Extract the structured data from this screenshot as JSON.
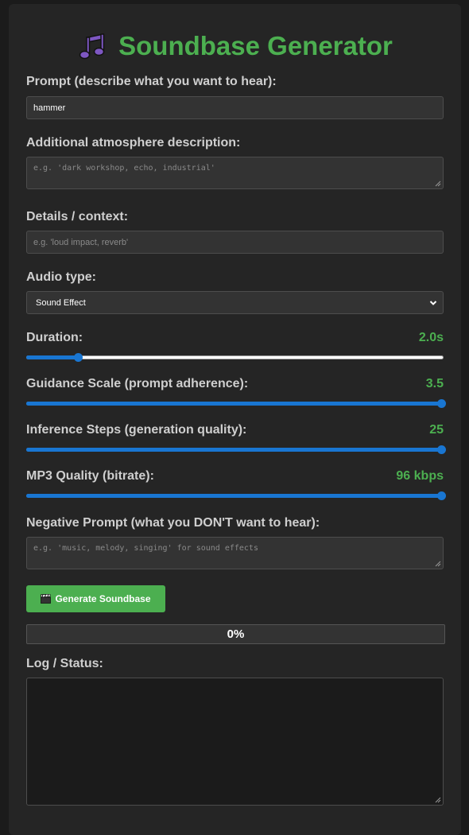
{
  "app": {
    "title": "Soundbase Generator",
    "title_icon": "music-note-icon",
    "accent_color": "#4caf50",
    "slider_color": "#1976d2"
  },
  "form": {
    "prompt": {
      "label": "Prompt (describe what you want to hear):",
      "value": "hammer",
      "placeholder": ""
    },
    "atmosphere": {
      "label": "Additional atmosphere description:",
      "value": "",
      "placeholder": "e.g. 'dark workshop, echo, industrial'"
    },
    "details": {
      "label": "Details / context:",
      "value": "",
      "placeholder": "e.g. 'loud impact, reverb'"
    },
    "audio_type": {
      "label": "Audio type:",
      "selected": "Sound Effect"
    },
    "duration": {
      "label": "Duration:",
      "display": "2.0s",
      "level": 0.12
    },
    "guidance": {
      "label": "Guidance Scale (prompt adherence):",
      "display": "3.5",
      "level": 1.0
    },
    "steps": {
      "label": "Inference Steps (generation quality):",
      "display": "25",
      "level": 1.0
    },
    "mp3": {
      "label": "MP3 Quality (bitrate):",
      "display": "96 kbps",
      "level": 1.0
    },
    "negative": {
      "label": "Negative Prompt (what you DON'T want to hear):",
      "value": "",
      "placeholder": "e.g. 'music, melody, singing' for sound effects"
    }
  },
  "generate": {
    "label": "Generate Soundbase",
    "icon": "clapperboard-icon"
  },
  "progress": {
    "text": "0%",
    "level": 0
  },
  "log": {
    "label": "Log / Status:",
    "content": ""
  }
}
